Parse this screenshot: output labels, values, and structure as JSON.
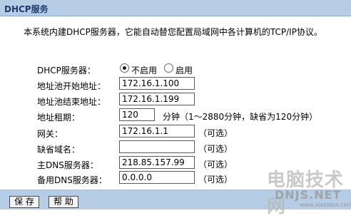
{
  "header": {
    "title": "DHCP服务"
  },
  "description": "本系统内建DHCP服务器，它能自动替您配置局域网中各计算机的TCP/IP协议。",
  "form": {
    "dhcp_server": {
      "label": "DHCP服务器：",
      "options": [
        "不启用",
        "启用"
      ],
      "selected": "不启用"
    },
    "pool_start": {
      "label": "地址池开始地址：",
      "value": "172.16.1.100"
    },
    "pool_end": {
      "label": "地址池结束地址：",
      "value": "172.16.1.199"
    },
    "lease": {
      "label": "地址租期：",
      "value": "120",
      "note": "分钟（1～2880分钟，缺省为120分钟）"
    },
    "gateway": {
      "label": "网关：",
      "value": "172.16.1.1",
      "note": "（可选）"
    },
    "domain": {
      "label": "缺省域名：",
      "value": "",
      "note": "（可选）"
    },
    "primary_dns": {
      "label": "主DNS服务器：",
      "value": "218.85.157.99",
      "note": "（可选）"
    },
    "secondary_dns": {
      "label": "备用DNS服务器：",
      "value": "0.0.0.0",
      "note": "（可选）"
    }
  },
  "buttons": {
    "save": "保 存",
    "help": "帮 助"
  },
  "watermark": {
    "line1": "电脑技术网",
    "line2": "DNJS.NET",
    "line3": "www.xiazaiba.com"
  }
}
